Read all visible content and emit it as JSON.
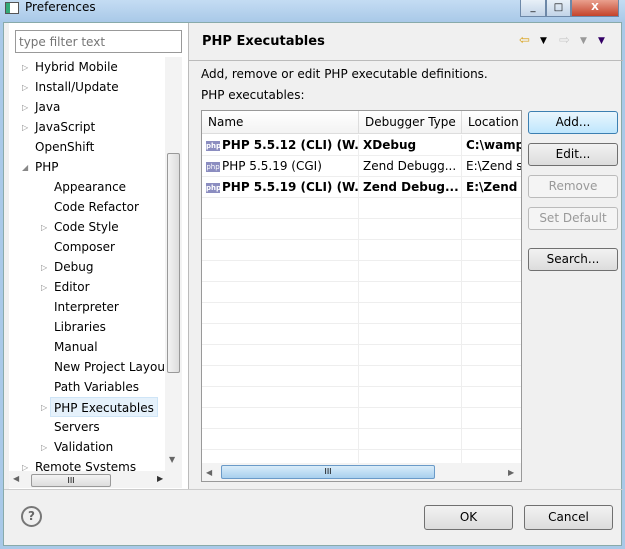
{
  "window": {
    "title": "Preferences",
    "minimize": "▭",
    "maximize": "□",
    "close": "X"
  },
  "filter": {
    "placeholder": "type filter text"
  },
  "tree": [
    {
      "label": "Hybrid Mobile",
      "level": 0,
      "arrow": "closed"
    },
    {
      "label": "Install/Update",
      "level": 0,
      "arrow": "closed"
    },
    {
      "label": "Java",
      "level": 0,
      "arrow": "closed"
    },
    {
      "label": "JavaScript",
      "level": 0,
      "arrow": "closed"
    },
    {
      "label": "OpenShift",
      "level": 0,
      "arrow": "none"
    },
    {
      "label": "PHP",
      "level": 0,
      "arrow": "open"
    },
    {
      "label": "Appearance",
      "level": 1,
      "arrow": "none"
    },
    {
      "label": "Code Refactor",
      "level": 1,
      "arrow": "none"
    },
    {
      "label": "Code Style",
      "level": 1,
      "arrow": "closed"
    },
    {
      "label": "Composer",
      "level": 1,
      "arrow": "none"
    },
    {
      "label": "Debug",
      "level": 1,
      "arrow": "closed"
    },
    {
      "label": "Editor",
      "level": 1,
      "arrow": "closed"
    },
    {
      "label": "Interpreter",
      "level": 1,
      "arrow": "none"
    },
    {
      "label": "Libraries",
      "level": 1,
      "arrow": "none"
    },
    {
      "label": "Manual",
      "level": 1,
      "arrow": "none"
    },
    {
      "label": "New Project Layout",
      "level": 1,
      "arrow": "none"
    },
    {
      "label": "Path Variables",
      "level": 1,
      "arrow": "none"
    },
    {
      "label": "PHP Executables",
      "level": 1,
      "arrow": "closed",
      "selected": true
    },
    {
      "label": "Servers",
      "level": 1,
      "arrow": "none"
    },
    {
      "label": "Validation",
      "level": 1,
      "arrow": "closed"
    },
    {
      "label": "Remote Systems",
      "level": 0,
      "arrow": "closed"
    }
  ],
  "page": {
    "title": "PHP Executables",
    "description": "Add, remove or edit PHP executable definitions.",
    "list_label": "PHP executables:"
  },
  "table": {
    "columns": [
      "Name",
      "Debugger Type",
      "Location"
    ],
    "rows": [
      {
        "name": "PHP 5.5.12 (CLI) (W...",
        "debugger": "XDebug",
        "location": "C:\\wamp",
        "bold": true
      },
      {
        "name": "PHP 5.5.19 (CGI)",
        "debugger": "Zend Debugg...",
        "location": "E:\\Zend s",
        "bold": false
      },
      {
        "name": "PHP 5.5.19 (CLI) (W...",
        "debugger": "Zend Debug...",
        "location": "E:\\Zend :",
        "bold": true
      }
    ]
  },
  "buttons": {
    "add": "Add...",
    "edit": "Edit...",
    "remove": "Remove",
    "set_default": "Set Default",
    "search": "Search...",
    "ok": "OK",
    "cancel": "Cancel"
  },
  "icons": {
    "php": "php",
    "help": "?",
    "scroll_grip": "III"
  }
}
